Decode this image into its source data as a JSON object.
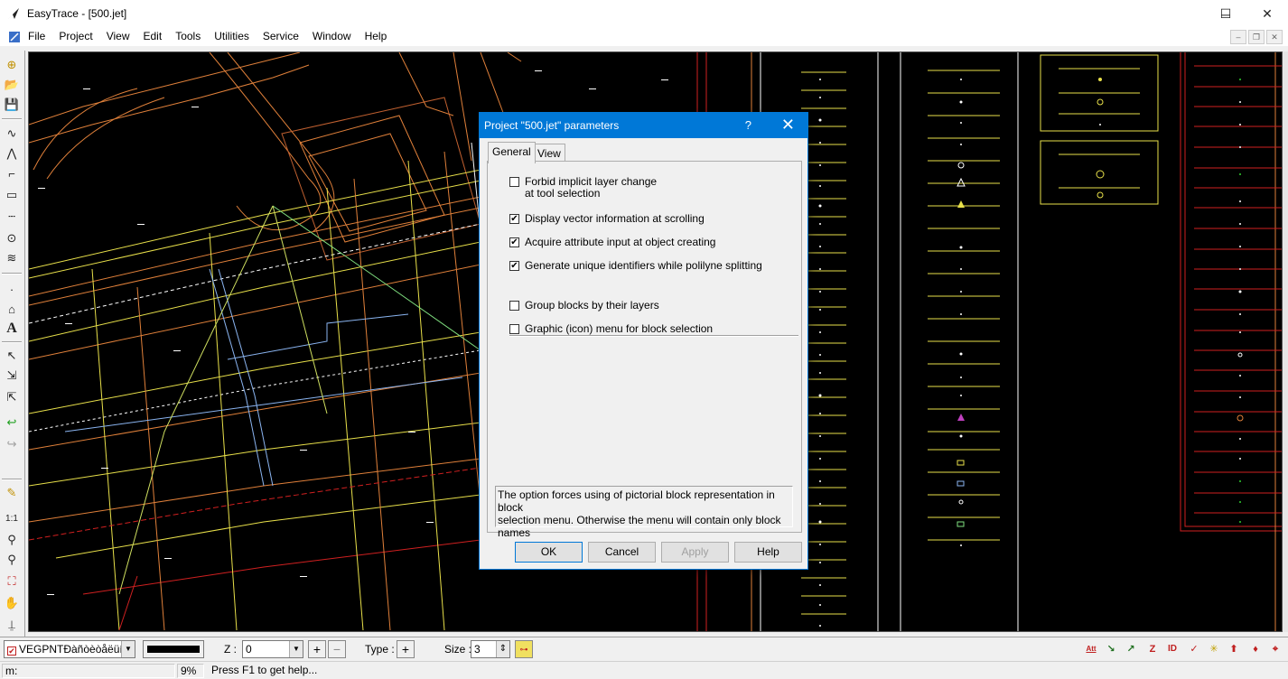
{
  "window": {
    "title": "EasyTrace - [500.jet]",
    "min_glyph": "─",
    "max_glyph": "☐",
    "close_glyph": "✕"
  },
  "menu": [
    "File",
    "Project",
    "View",
    "Edit",
    "Tools",
    "Utilities",
    "Service",
    "Window",
    "Help"
  ],
  "mdi_buttons": [
    "–",
    "❐",
    "✕"
  ],
  "dialog": {
    "title": "Project \"500.jet\" parameters",
    "help_glyph": "?",
    "close_glyph": "✕",
    "tabs": [
      "General",
      "View"
    ],
    "options": [
      {
        "label_line1": "Forbid implicit layer change",
        "label_line2": "at tool selection",
        "checked": false
      },
      {
        "label_line1": "Display vector information at scrolling",
        "label_line2": "",
        "checked": true
      },
      {
        "label_line1": "Acquire attribute input at object creating",
        "label_line2": "",
        "checked": true
      },
      {
        "label_line1": "Generate unique identifiers while polilyne splitting",
        "label_line2": "",
        "checked": true
      },
      {
        "label_line1": "Group blocks by their layers",
        "label_line2": "",
        "checked": false
      },
      {
        "label_line1": "Graphic (icon) menu for block selection",
        "label_line2": "",
        "checked": false
      }
    ],
    "help_text_line1": "The option forces using of pictorial block representation in block",
    "help_text_line2": "selection menu. Otherwise the menu will contain only block names",
    "buttons": {
      "ok": "OK",
      "cancel": "Cancel",
      "apply": "Apply",
      "help": "Help"
    },
    "check_glyph": "✔"
  },
  "bottombar": {
    "layer": "VEGPNTÐàñòèòåëüíî",
    "z_label": "Z :",
    "z_value": "0",
    "type_label": "Type :",
    "size_label": "Size :",
    "size_value": "3",
    "plus": "+",
    "minus": "−",
    "dropdown_glyph": "▼",
    "spin_glyph": "⇕",
    "right_icons": [
      "Att",
      "↘",
      "↗",
      "Z",
      "ID",
      "✓",
      "✳",
      "⬆",
      "♦",
      "⌖"
    ]
  },
  "status": {
    "coord_label": "m:",
    "zoom": "9%",
    "message": "Press F1 to get help..."
  },
  "tools": [
    "⊕",
    "📂",
    "💾",
    "∿",
    "⋀",
    "⌐",
    "▭",
    "┄",
    "⊙",
    "≋",
    "·",
    "⌂",
    "A",
    "↖",
    "⇲",
    "⇱",
    "↩",
    "↪",
    "✎",
    "1:1",
    "⚲",
    "⚲",
    "⛶",
    "✋",
    "⍊"
  ],
  "colors": {
    "accent": "#0078d7",
    "canvas_bg": "#000000",
    "line_orange": "#e0803a",
    "line_yellow": "#e8e04a",
    "line_white": "#ffffff",
    "line_red": "#d02020",
    "line_blue": "#8ab4f0"
  }
}
